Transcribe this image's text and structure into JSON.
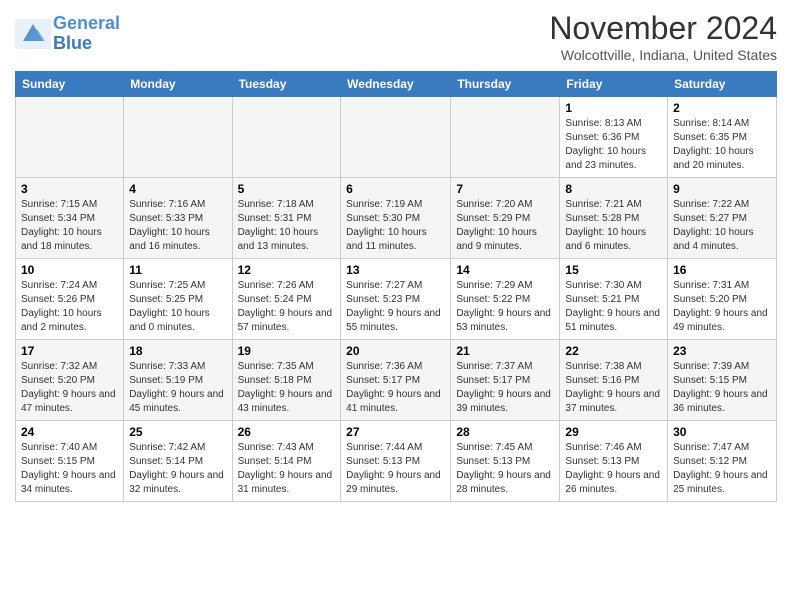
{
  "header": {
    "logo_line1": "General",
    "logo_line2": "Blue",
    "month": "November 2024",
    "location": "Wolcottville, Indiana, United States"
  },
  "weekdays": [
    "Sunday",
    "Monday",
    "Tuesday",
    "Wednesday",
    "Thursday",
    "Friday",
    "Saturday"
  ],
  "weeks": [
    [
      {
        "day": "",
        "empty": true
      },
      {
        "day": "",
        "empty": true
      },
      {
        "day": "",
        "empty": true
      },
      {
        "day": "",
        "empty": true
      },
      {
        "day": "",
        "empty": true
      },
      {
        "day": "1",
        "sunrise": "8:13 AM",
        "sunset": "6:36 PM",
        "daylight": "10 hours and 23 minutes."
      },
      {
        "day": "2",
        "sunrise": "8:14 AM",
        "sunset": "6:35 PM",
        "daylight": "10 hours and 20 minutes."
      }
    ],
    [
      {
        "day": "3",
        "sunrise": "7:15 AM",
        "sunset": "5:34 PM",
        "daylight": "10 hours and 18 minutes."
      },
      {
        "day": "4",
        "sunrise": "7:16 AM",
        "sunset": "5:33 PM",
        "daylight": "10 hours and 16 minutes."
      },
      {
        "day": "5",
        "sunrise": "7:18 AM",
        "sunset": "5:31 PM",
        "daylight": "10 hours and 13 minutes."
      },
      {
        "day": "6",
        "sunrise": "7:19 AM",
        "sunset": "5:30 PM",
        "daylight": "10 hours and 11 minutes."
      },
      {
        "day": "7",
        "sunrise": "7:20 AM",
        "sunset": "5:29 PM",
        "daylight": "10 hours and 9 minutes."
      },
      {
        "day": "8",
        "sunrise": "7:21 AM",
        "sunset": "5:28 PM",
        "daylight": "10 hours and 6 minutes."
      },
      {
        "day": "9",
        "sunrise": "7:22 AM",
        "sunset": "5:27 PM",
        "daylight": "10 hours and 4 minutes."
      }
    ],
    [
      {
        "day": "10",
        "sunrise": "7:24 AM",
        "sunset": "5:26 PM",
        "daylight": "10 hours and 2 minutes."
      },
      {
        "day": "11",
        "sunrise": "7:25 AM",
        "sunset": "5:25 PM",
        "daylight": "10 hours and 0 minutes."
      },
      {
        "day": "12",
        "sunrise": "7:26 AM",
        "sunset": "5:24 PM",
        "daylight": "9 hours and 57 minutes."
      },
      {
        "day": "13",
        "sunrise": "7:27 AM",
        "sunset": "5:23 PM",
        "daylight": "9 hours and 55 minutes."
      },
      {
        "day": "14",
        "sunrise": "7:29 AM",
        "sunset": "5:22 PM",
        "daylight": "9 hours and 53 minutes."
      },
      {
        "day": "15",
        "sunrise": "7:30 AM",
        "sunset": "5:21 PM",
        "daylight": "9 hours and 51 minutes."
      },
      {
        "day": "16",
        "sunrise": "7:31 AM",
        "sunset": "5:20 PM",
        "daylight": "9 hours and 49 minutes."
      }
    ],
    [
      {
        "day": "17",
        "sunrise": "7:32 AM",
        "sunset": "5:20 PM",
        "daylight": "9 hours and 47 minutes."
      },
      {
        "day": "18",
        "sunrise": "7:33 AM",
        "sunset": "5:19 PM",
        "daylight": "9 hours and 45 minutes."
      },
      {
        "day": "19",
        "sunrise": "7:35 AM",
        "sunset": "5:18 PM",
        "daylight": "9 hours and 43 minutes."
      },
      {
        "day": "20",
        "sunrise": "7:36 AM",
        "sunset": "5:17 PM",
        "daylight": "9 hours and 41 minutes."
      },
      {
        "day": "21",
        "sunrise": "7:37 AM",
        "sunset": "5:17 PM",
        "daylight": "9 hours and 39 minutes."
      },
      {
        "day": "22",
        "sunrise": "7:38 AM",
        "sunset": "5:16 PM",
        "daylight": "9 hours and 37 minutes."
      },
      {
        "day": "23",
        "sunrise": "7:39 AM",
        "sunset": "5:15 PM",
        "daylight": "9 hours and 36 minutes."
      }
    ],
    [
      {
        "day": "24",
        "sunrise": "7:40 AM",
        "sunset": "5:15 PM",
        "daylight": "9 hours and 34 minutes."
      },
      {
        "day": "25",
        "sunrise": "7:42 AM",
        "sunset": "5:14 PM",
        "daylight": "9 hours and 32 minutes."
      },
      {
        "day": "26",
        "sunrise": "7:43 AM",
        "sunset": "5:14 PM",
        "daylight": "9 hours and 31 minutes."
      },
      {
        "day": "27",
        "sunrise": "7:44 AM",
        "sunset": "5:13 PM",
        "daylight": "9 hours and 29 minutes."
      },
      {
        "day": "28",
        "sunrise": "7:45 AM",
        "sunset": "5:13 PM",
        "daylight": "9 hours and 28 minutes."
      },
      {
        "day": "29",
        "sunrise": "7:46 AM",
        "sunset": "5:13 PM",
        "daylight": "9 hours and 26 minutes."
      },
      {
        "day": "30",
        "sunrise": "7:47 AM",
        "sunset": "5:12 PM",
        "daylight": "9 hours and 25 minutes."
      }
    ]
  ]
}
